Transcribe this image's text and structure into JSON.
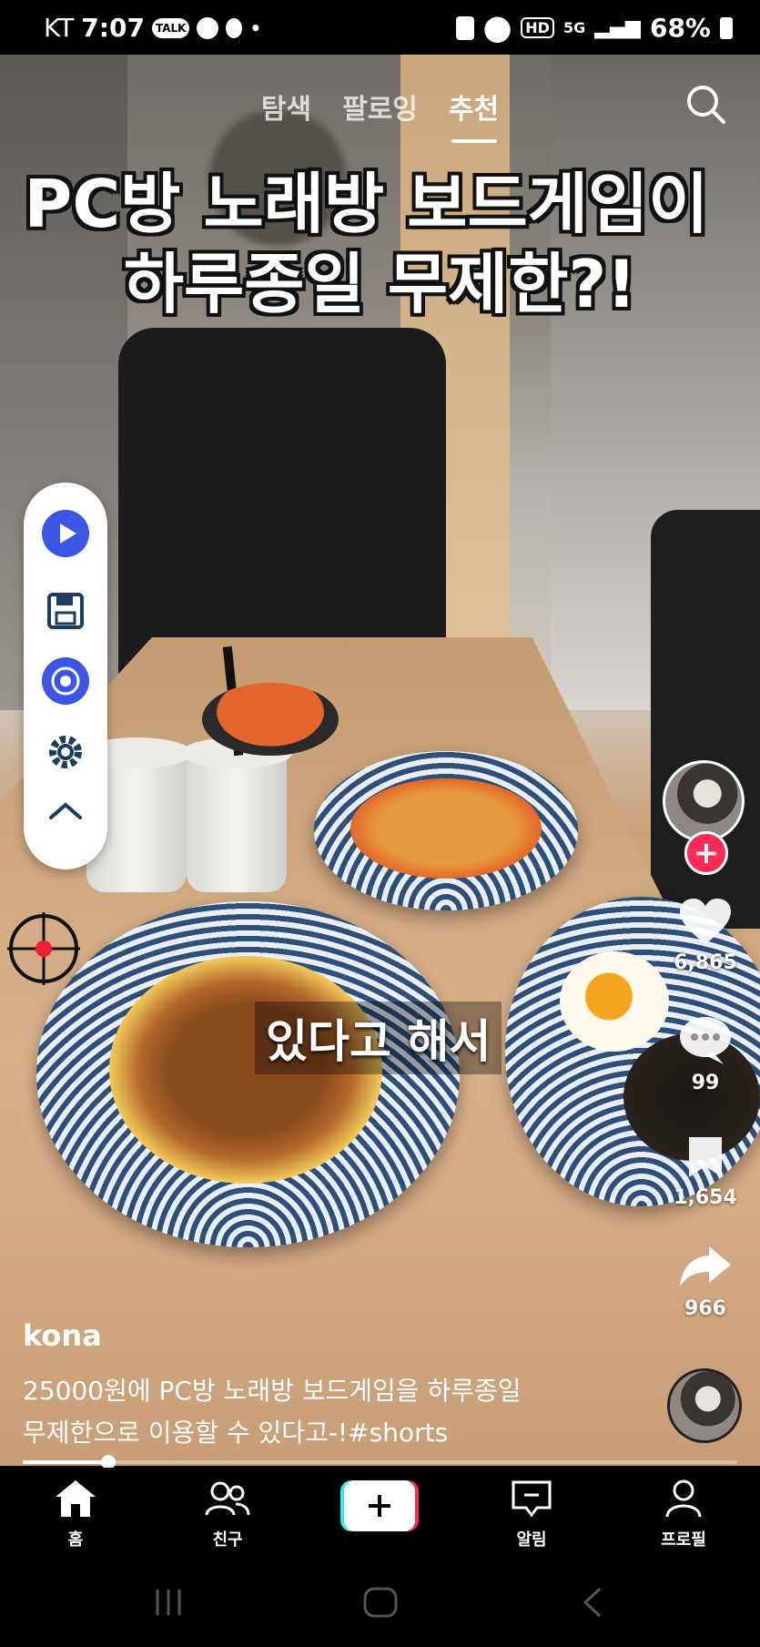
{
  "status_bar": {
    "carrier": "KT",
    "time": "7:07",
    "talk_badge": "TALK",
    "battery": "68%",
    "hd_label": "HD",
    "network_label": "5G"
  },
  "top_tabs": {
    "items": [
      {
        "label": "탐색"
      },
      {
        "label": "팔로잉"
      },
      {
        "label": "추천"
      }
    ],
    "active_index": 2
  },
  "video": {
    "caption_line1": "PC방 노래방 보드게임이",
    "caption_line2": "하루종일 무제한?!",
    "subtitle": "있다고 해서"
  },
  "right_rail": {
    "like_count": "6,865",
    "comment_count": "99",
    "bookmark_count": "1,654",
    "share_count": "966"
  },
  "post": {
    "author": "kona",
    "description_line1": "25000원에 PC방 노래방 보드게임을 하루종일",
    "description_line2": "무제한으로 이용할 수 있다고-!#shorts",
    "progress": 0.12
  },
  "bottom_nav": {
    "home": "홈",
    "friends": "친구",
    "inbox": "알림",
    "profile": "프로필"
  },
  "colors": {
    "accent": "#fe2c55",
    "panel_blue": "#3b55e6"
  },
  "floating_panel_icons": [
    "play-icon",
    "save-icon",
    "touch-icon",
    "gear-icon",
    "chevron-up-icon"
  ]
}
